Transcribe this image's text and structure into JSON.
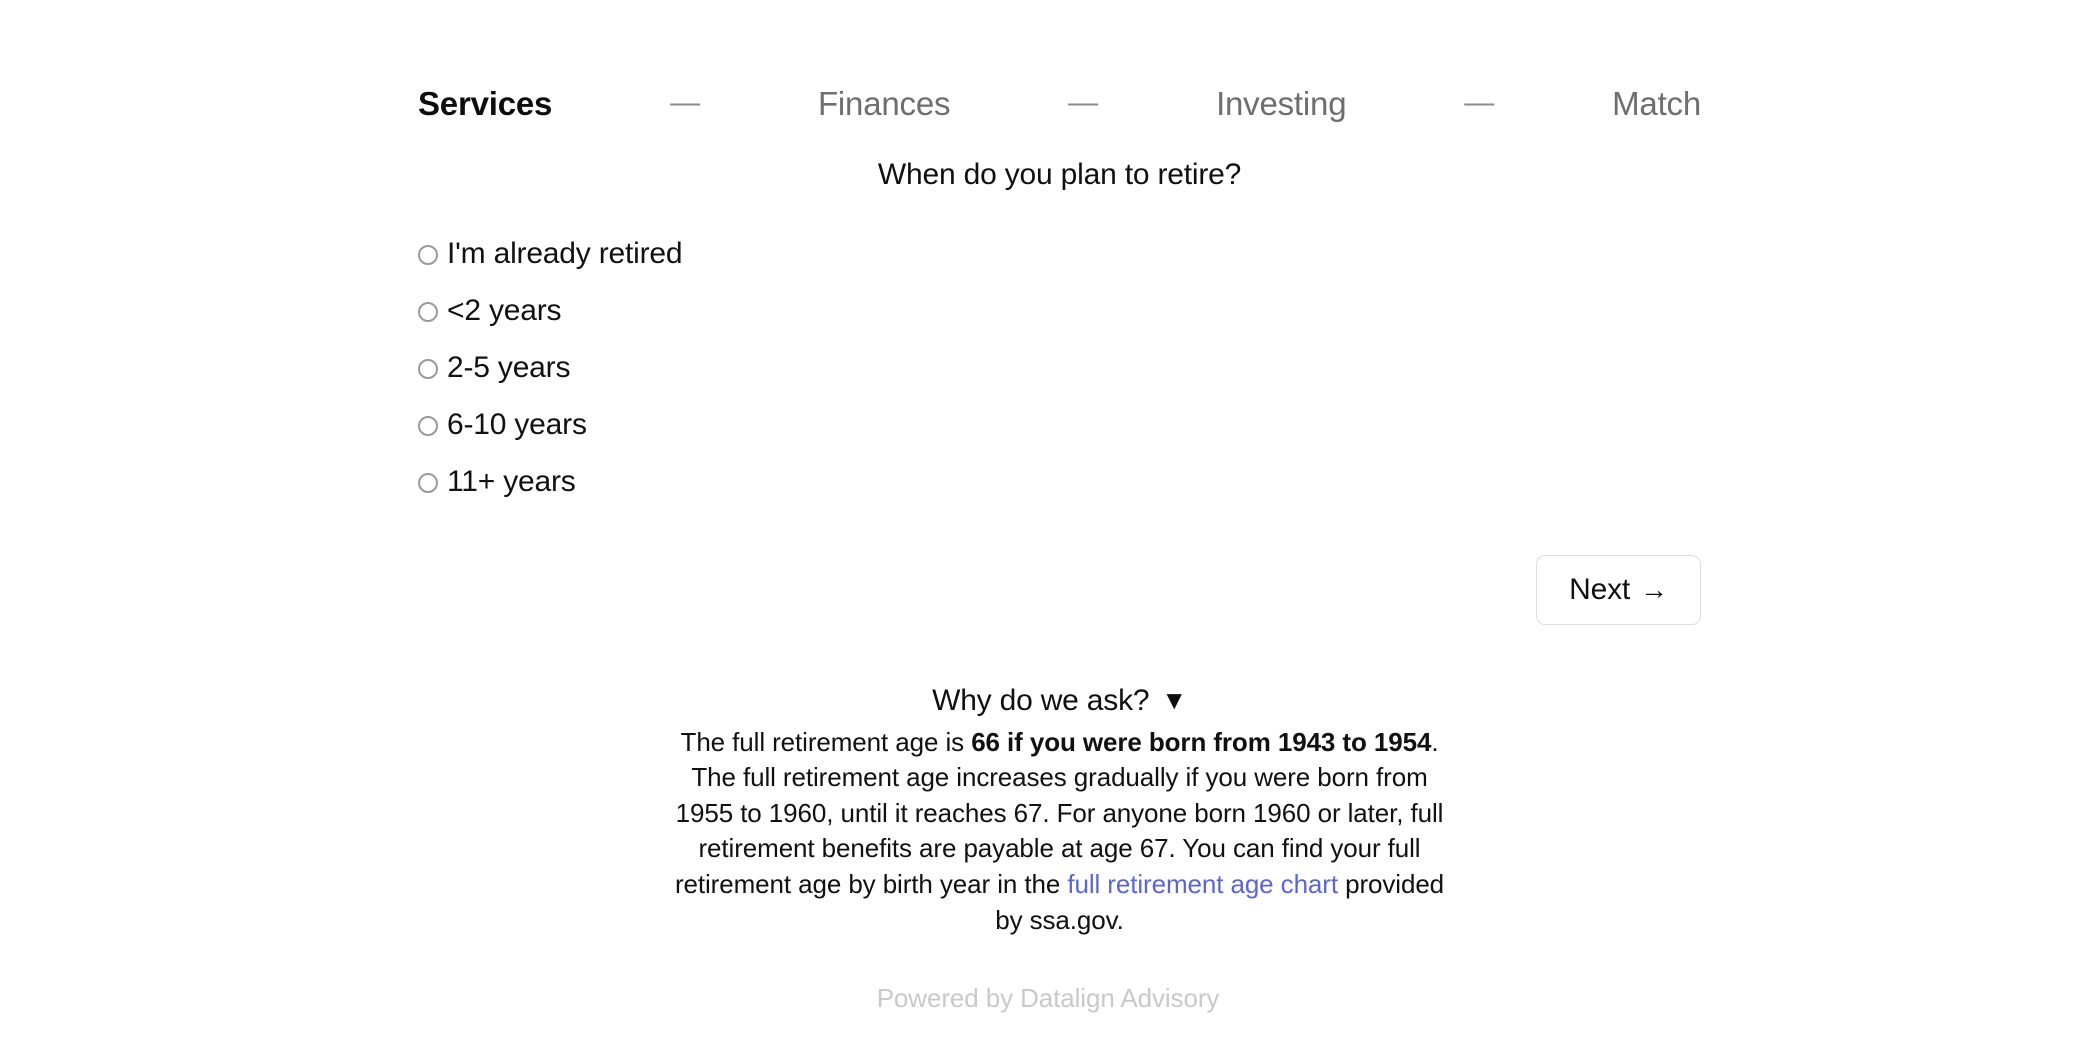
{
  "steps": {
    "separator": "—",
    "items": [
      {
        "label": "Services",
        "active": true
      },
      {
        "label": "Finances",
        "active": false
      },
      {
        "label": "Investing",
        "active": false
      },
      {
        "label": "Match",
        "active": false
      }
    ]
  },
  "question": {
    "text": "When do you plan to retire?"
  },
  "options": [
    {
      "label": "I'm already retired",
      "selected": false
    },
    {
      "label": "<2 years",
      "selected": false
    },
    {
      "label": "2-5 years",
      "selected": false
    },
    {
      "label": "6-10 years",
      "selected": false
    },
    {
      "label": "11+ years",
      "selected": false
    }
  ],
  "next_button": {
    "label": "Next",
    "arrow": "→"
  },
  "why": {
    "title": "Why do we ask?",
    "caret": "▼",
    "body_part1": "The full retirement age is ",
    "body_bold": "66 if you were born from 1943 to 1954",
    "body_part2": ". The full retirement age increases gradually if you were born from 1955 to 1960, until it reaches 67. For anyone born 1960 or later, full retirement benefits are payable at age 67. You can find your full retirement age by birth year in the ",
    "link_text": "full retirement age chart",
    "body_part3": " provided by ssa.gov.",
    "link_color": "#5a66d6"
  },
  "footer": {
    "text": "Powered by Datalign Advisory"
  }
}
